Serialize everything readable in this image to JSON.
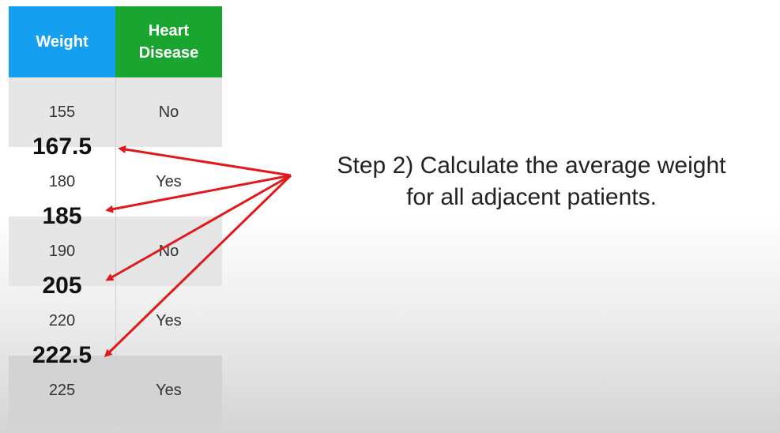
{
  "table": {
    "headers": [
      "Weight",
      "Heart\nDisease"
    ],
    "header_weight": "Weight",
    "header_heart_line1": "Heart",
    "header_heart_line2": "Disease",
    "rows": [
      {
        "weight": "155",
        "heart_disease": "No"
      },
      {
        "weight": "180",
        "heart_disease": "Yes"
      },
      {
        "weight": "190",
        "heart_disease": "No"
      },
      {
        "weight": "220",
        "heart_disease": "Yes"
      },
      {
        "weight": "225",
        "heart_disease": "Yes"
      }
    ]
  },
  "averages": [
    "167.5",
    "185",
    "205",
    "222.5"
  ],
  "caption": {
    "line1": "Step 2) Calculate the average weight",
    "line2": "for all adjacent patients."
  },
  "colors": {
    "weight_header": "#159ff0",
    "heart_header": "#1aa531",
    "arrow": "#e0191b"
  }
}
